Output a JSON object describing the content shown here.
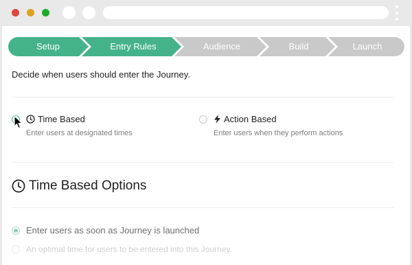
{
  "stepper": {
    "steps": [
      {
        "label": "Setup",
        "state": "done"
      },
      {
        "label": "Entry Rules",
        "state": "current"
      },
      {
        "label": "Audience",
        "state": "todo"
      },
      {
        "label": "Build",
        "state": "todo"
      },
      {
        "label": "Launch",
        "state": "todo"
      }
    ],
    "colors": {
      "active": "#45b38a",
      "inactive": "#c9c9c9"
    }
  },
  "intro_text": "Decide when users should enter the Journey.",
  "entry_options": {
    "time_based": {
      "title": "Time Based",
      "description": "Enter users at designated times",
      "selected": true,
      "icon": "clock-icon"
    },
    "action_based": {
      "title": "Action Based",
      "description": "Enter users when they perform actions",
      "selected": false,
      "icon": "lightning-icon"
    }
  },
  "time_based_options": {
    "heading": "Time Based Options",
    "icon": "clock-icon",
    "choices": [
      {
        "label": "Enter users as soon as Journey is launched",
        "selected": true
      },
      {
        "label": "An optimal time for users to be entered into this Journey.",
        "selected": false
      }
    ]
  }
}
